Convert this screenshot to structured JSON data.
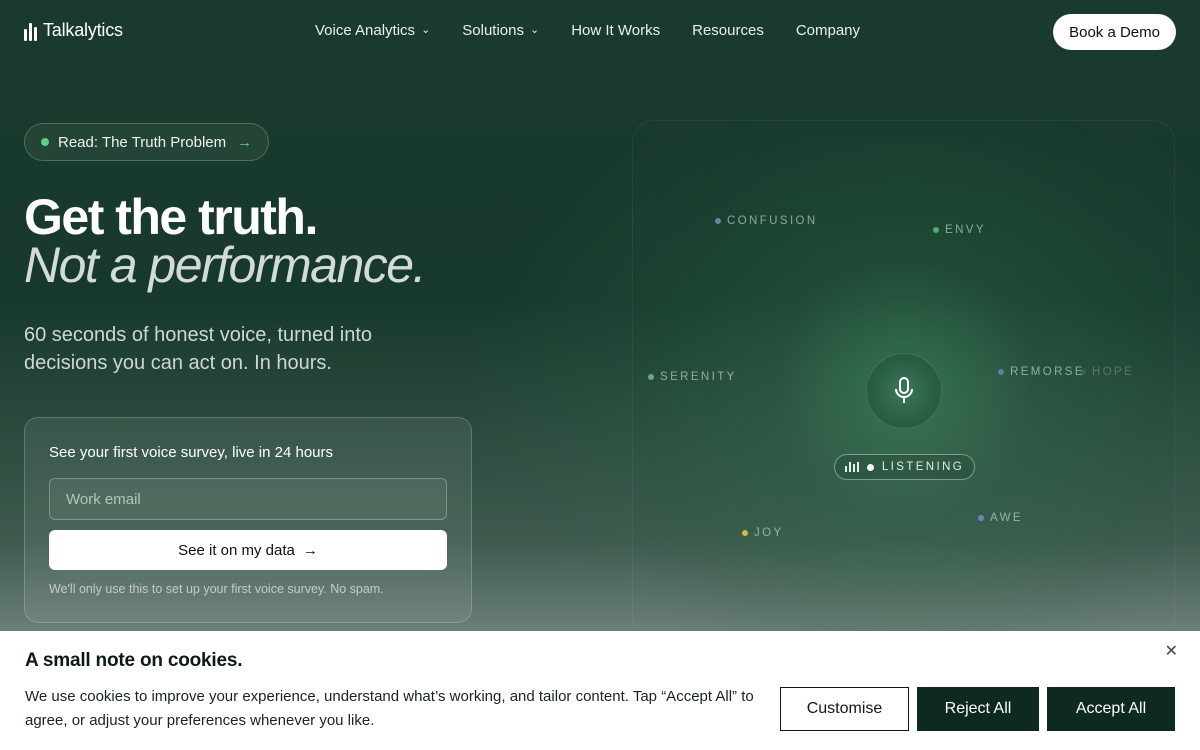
{
  "brand": {
    "name": "Talkalytics"
  },
  "nav": {
    "items": [
      {
        "label": "Voice Analytics",
        "dropdown": true
      },
      {
        "label": "Solutions",
        "dropdown": true
      },
      {
        "label": "How It Works",
        "dropdown": false
      },
      {
        "label": "Resources",
        "dropdown": false
      },
      {
        "label": "Company",
        "dropdown": false
      }
    ],
    "cta": "Book a Demo"
  },
  "hero": {
    "pill": "Read: The Truth Problem",
    "title_line1": "Get the truth.",
    "title_line2": "Not a performance.",
    "subtitle": "60 seconds of honest voice, turned into decisions you can act on. In hours."
  },
  "signup": {
    "title": "See your first voice survey, live in 24 hours",
    "email_placeholder": "Work email",
    "email_value": "",
    "button": "See it on my data",
    "note": "We'll only use this to set up your first voice survey. No spam."
  },
  "visual": {
    "emotions": [
      {
        "label": "CONFUSION",
        "color": "#5a8ba0"
      },
      {
        "label": "ENVY",
        "color": "#4fae6a"
      },
      {
        "label": "SERENITY",
        "color": "#6aa88a"
      },
      {
        "label": "REMORSE",
        "color": "#5c7fa3"
      },
      {
        "label": "HOPE",
        "color": "#4a7a6a"
      },
      {
        "label": "JOY",
        "color": "#d2b94a"
      },
      {
        "label": "AWE",
        "color": "#7d7fb8"
      }
    ],
    "status": "LISTENING"
  },
  "cookie": {
    "title": "A small note on cookies.",
    "text": "We use cookies to improve your experience, understand what’s working, and tailor content. Tap “Accept All” to agree, or adjust your preferences whenever you like.",
    "customise": "Customise",
    "reject": "Reject All",
    "accept": "Accept All"
  },
  "colors": {
    "accent": "#5fd08a",
    "dark_button": "#0e2a1f",
    "background": "#143527"
  }
}
